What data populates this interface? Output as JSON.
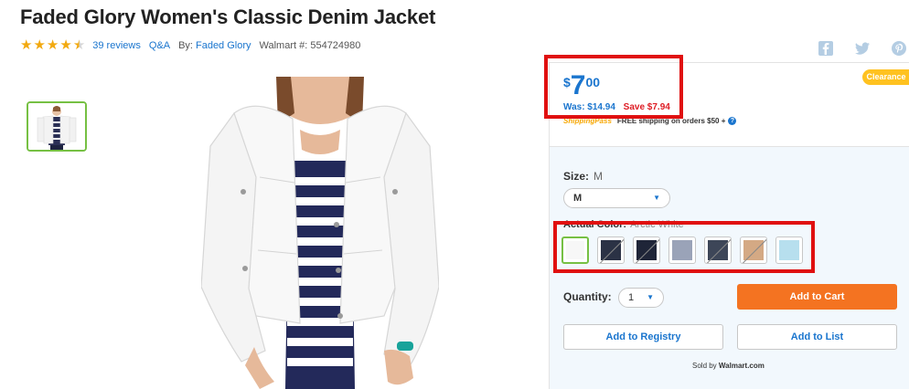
{
  "product": {
    "title": "Faded Glory Women's Classic Denim Jacket",
    "rating": 4.5,
    "reviews": "39 reviews",
    "qa": "Q&A",
    "by_prefix": "By:",
    "brand": "Faded Glory",
    "walmart_number": "Walmart #: 554724980"
  },
  "social": {
    "icons": [
      "facebook-icon",
      "twitter-icon",
      "pinterest-icon"
    ]
  },
  "price": {
    "currency": "$",
    "dollars": "7",
    "cents": "00",
    "was": "Was: $14.94",
    "save": "Save $7.94",
    "badge": "Clearance",
    "shipping_pass": "ShippingPass",
    "shipping_text": "FREE shipping on orders $50 +",
    "help_icon": "?"
  },
  "options": {
    "size_label": "Size:",
    "size_value": "M",
    "size_selected": "M",
    "color_label": "Actual Color:",
    "color_value": "Arctic White",
    "swatches": [
      {
        "color": "#f7f7f7",
        "selected": true,
        "unavailable": false
      },
      {
        "color": "#2b3245",
        "selected": false,
        "unavailable": true
      },
      {
        "color": "#1f2538",
        "selected": false,
        "unavailable": true
      },
      {
        "color": "#9aa3b8",
        "selected": false,
        "unavailable": false
      },
      {
        "color": "#3d4658",
        "selected": false,
        "unavailable": true
      },
      {
        "color": "#d4a984",
        "selected": false,
        "unavailable": true
      },
      {
        "color": "#b7dfee",
        "selected": false,
        "unavailable": false
      }
    ],
    "qty_label": "Quantity:",
    "qty_value": "1"
  },
  "actions": {
    "add_to_cart": "Add to Cart",
    "add_to_registry": "Add to Registry",
    "add_to_list": "Add to List"
  },
  "seller": {
    "prefix": "Sold by",
    "name": "Walmart.com"
  },
  "colors": {
    "accent": "#1a75ce",
    "cart": "#f47321",
    "badge": "#ffc220",
    "save": "#de1c24",
    "highlight": "#e01010"
  }
}
